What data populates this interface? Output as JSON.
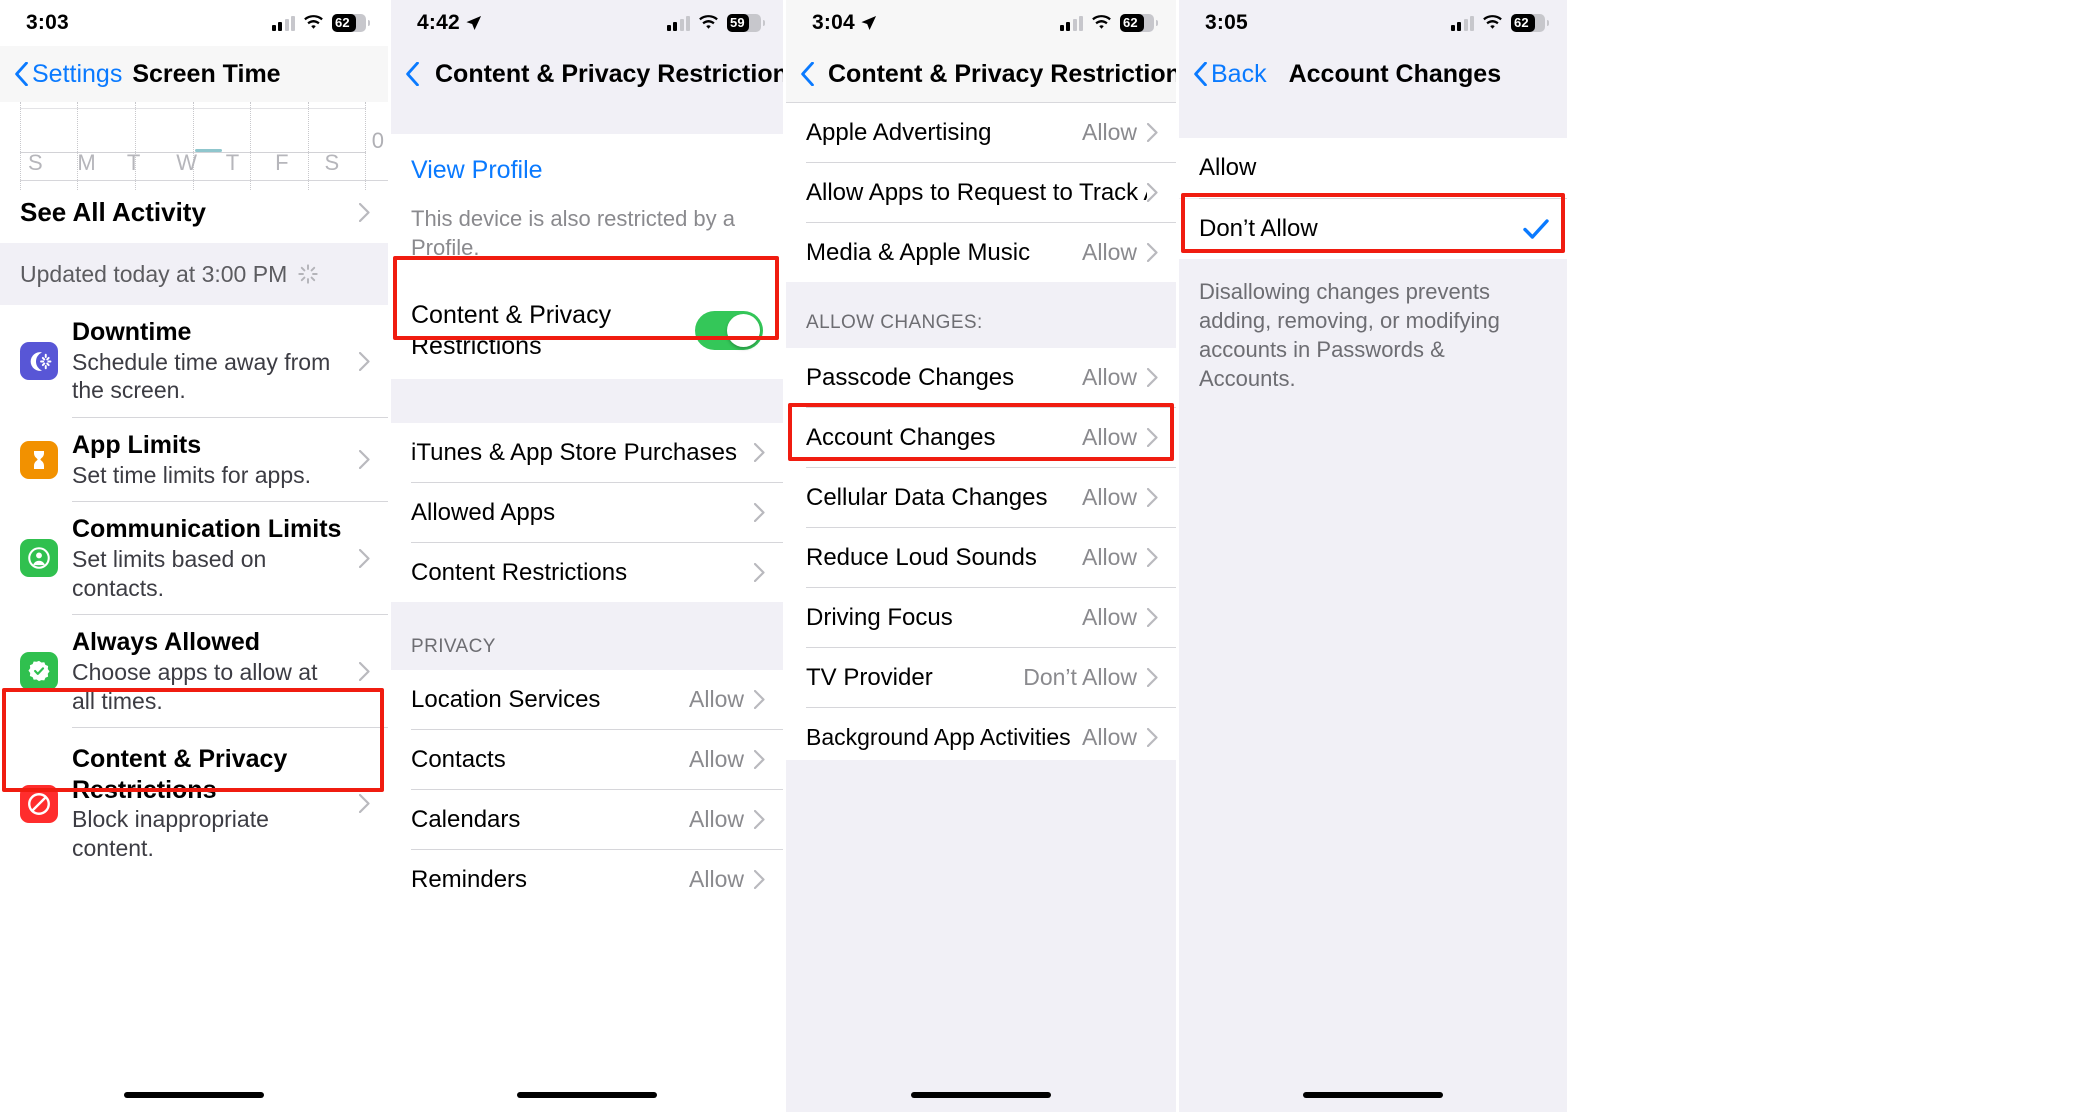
{
  "colors": {
    "accent_blue": "#0a7aff",
    "highlight_red": "#f01c10",
    "toggle_green": "#34c759",
    "group_bg": "#f1f0f6",
    "separator": "#d6d6da"
  },
  "panel1": {
    "status": {
      "time": "3:03",
      "battery": "62",
      "wifi_icon": "wifi-icon",
      "cellular_icon": "cellular-bars-icon",
      "battery_icon": "battery-icon"
    },
    "nav": {
      "back_label": "Settings",
      "title": "Screen Time",
      "back_icon": "chevron-left-icon"
    },
    "chart": {
      "day_labels": [
        "S",
        "M",
        "T",
        "W",
        "T",
        "F",
        "S"
      ],
      "axis_max_label": "0"
    },
    "see_all_label": "See All Activity",
    "updated_text": "Updated today at 3:00 PM",
    "updated_icon": "sparkle-icon",
    "items": [
      {
        "title": "Downtime",
        "subtitle": "Schedule time away from the screen.",
        "icon": "downtime-moon-icon",
        "icon_color": "#5856d6",
        "chevron": "chevron-right-icon"
      },
      {
        "title": "App Limits",
        "subtitle": "Set time limits for apps.",
        "icon": "hourglass-icon",
        "icon_color": "#f29100",
        "chevron": "chevron-right-icon"
      },
      {
        "title": "Communication Limits",
        "subtitle": "Set limits based on contacts.",
        "icon": "person-circle-icon",
        "icon_color": "#30c04f",
        "chevron": "chevron-right-icon"
      },
      {
        "title": "Always Allowed",
        "subtitle": "Choose apps to allow at all times.",
        "icon": "badge-check-icon",
        "icon_color": "#30c04f",
        "chevron": "chevron-right-icon"
      },
      {
        "title": "Content & Privacy Restrictions",
        "subtitle": "Block inappropriate content.",
        "icon": "no-entry-icon",
        "icon_color": "#ff2d2d",
        "chevron": "chevron-right-icon",
        "highlighted": true
      }
    ]
  },
  "panel2": {
    "status": {
      "time": "4:42",
      "battery": "59",
      "location_icon": "location-arrow-icon"
    },
    "nav": {
      "title": "Content & Privacy Restrictions",
      "back_icon": "chevron-left-icon"
    },
    "view_profile_label": "View Profile",
    "profile_note": "This device is also restricted by a Profile.",
    "toggle_row": {
      "label": "Content & Privacy Restrictions",
      "state": "on",
      "highlighted": true
    },
    "rows": [
      {
        "label": "iTunes & App Store Purchases",
        "value": "",
        "chevron": "chevron-right-icon"
      },
      {
        "label": "Allowed Apps",
        "value": "",
        "chevron": "chevron-right-icon"
      },
      {
        "label": "Content Restrictions",
        "value": "",
        "chevron": "chevron-right-icon"
      }
    ],
    "privacy_header": "PRIVACY",
    "privacy_rows": [
      {
        "label": "Location Services",
        "value": "Allow",
        "chevron": "chevron-right-icon"
      },
      {
        "label": "Contacts",
        "value": "Allow",
        "chevron": "chevron-right-icon"
      },
      {
        "label": "Calendars",
        "value": "Allow",
        "chevron": "chevron-right-icon"
      },
      {
        "label": "Reminders",
        "value": "Allow",
        "chevron": "chevron-right-icon"
      }
    ]
  },
  "panel3": {
    "status": {
      "time": "3:04",
      "battery": "62",
      "location_icon": "location-arrow-icon"
    },
    "nav": {
      "title": "Content & Privacy Restrictions",
      "back_icon": "chevron-left-icon"
    },
    "top_rows": [
      {
        "label": "Apple Advertising",
        "value": "Allow",
        "chevron": "chevron-right-icon"
      },
      {
        "label": "Allow Apps to Request to Track A",
        "value": "",
        "chevron": "chevron-right-icon"
      },
      {
        "label": "Media & Apple Music",
        "value": "Allow",
        "chevron": "chevron-right-icon"
      }
    ],
    "section_header": "ALLOW CHANGES:",
    "change_rows": [
      {
        "label": "Passcode Changes",
        "value": "Allow",
        "chevron": "chevron-right-icon"
      },
      {
        "label": "Account Changes",
        "value": "Allow",
        "chevron": "chevron-right-icon",
        "highlighted": true
      },
      {
        "label": "Cellular Data Changes",
        "value": "Allow",
        "chevron": "chevron-right-icon"
      },
      {
        "label": "Reduce Loud Sounds",
        "value": "Allow",
        "chevron": "chevron-right-icon"
      },
      {
        "label": "Driving Focus",
        "value": "Allow",
        "chevron": "chevron-right-icon"
      },
      {
        "label": "TV Provider",
        "value": "Don’t Allow",
        "chevron": "chevron-right-icon"
      },
      {
        "label": "Background App Activities",
        "value": "Allow",
        "chevron": "chevron-right-icon"
      }
    ]
  },
  "panel4": {
    "status": {
      "time": "3:05",
      "battery": "62"
    },
    "nav": {
      "back_label": "Back",
      "title": "Account Changes",
      "back_icon": "chevron-left-icon"
    },
    "options": [
      {
        "label": "Allow",
        "selected": false
      },
      {
        "label": "Don’t Allow",
        "selected": true,
        "highlighted": true,
        "check_icon": "checkmark-icon"
      }
    ],
    "footnote": "Disallowing changes prevents adding, removing, or modifying accounts in Passwords & Accounts."
  }
}
